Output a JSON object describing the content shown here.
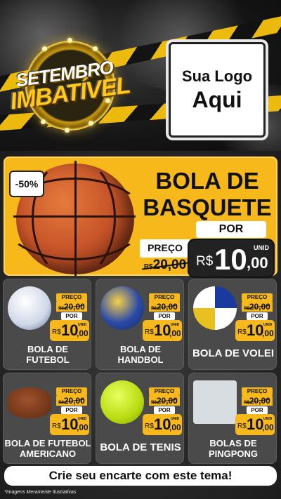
{
  "header": {
    "badge_line1": "SETEMBRO",
    "badge_line2": "IMBATÍVEL",
    "logo_line1": "Sua Logo",
    "logo_line2": "Aqui"
  },
  "featured": {
    "discount": "-50%",
    "title_line1": "BOLA DE",
    "title_line2": "BASQUETE",
    "preco_label": "PREÇO",
    "old_currency": "R$",
    "old_price": "20,00",
    "por_label": "POR",
    "currency": "R$",
    "price_int": "10",
    "price_dec": ",00",
    "unit": "UNID",
    "image_icon": "basketball-icon"
  },
  "products": [
    {
      "name_line1": "BOLA DE",
      "name_line2": "FUTEBOL",
      "icon": "soccer-ball-icon",
      "preco_label": "PREÇO",
      "old_currency": "R$",
      "old_price": "20,00",
      "por_label": "POR",
      "currency": "R$",
      "price_int": "10",
      "price_dec": ",00",
      "unit": "UNID"
    },
    {
      "name_line1": "BOLA DE",
      "name_line2": "HANDBOL",
      "icon": "handball-icon",
      "preco_label": "PREÇO",
      "old_currency": "R$",
      "old_price": "20,00",
      "por_label": "POR",
      "currency": "R$",
      "price_int": "10",
      "price_dec": ",00",
      "unit": "UNID"
    },
    {
      "name_line1": "BOLA DE VOLEI",
      "name_line2": "",
      "icon": "volleyball-icon",
      "preco_label": "PREÇO",
      "old_currency": "R$",
      "old_price": "20,00",
      "por_label": "POR",
      "currency": "R$",
      "price_int": "10",
      "price_dec": ",00",
      "unit": "UNID"
    },
    {
      "name_line1": "BOLA DE FUTEBOL",
      "name_line2": "AMERICANO",
      "icon": "football-icon",
      "preco_label": "PREÇO",
      "old_currency": "R$",
      "old_price": "20,00",
      "por_label": "POR",
      "currency": "R$",
      "price_int": "10",
      "price_dec": ",00",
      "unit": "UNID"
    },
    {
      "name_line1": "BOLA DE TENIS",
      "name_line2": "",
      "icon": "tennis-ball-icon",
      "preco_label": "PREÇO",
      "old_currency": "R$",
      "old_price": "20,00",
      "por_label": "POR",
      "currency": "R$",
      "price_int": "10",
      "price_dec": ",00",
      "unit": "UNID"
    },
    {
      "name_line1": "BOLAS DE",
      "name_line2": "PINGPONG",
      "icon": "pingpong-balls-icon",
      "preco_label": "PREÇO",
      "old_currency": "R$",
      "old_price": "20,00",
      "por_label": "POR",
      "currency": "R$",
      "price_int": "10",
      "price_dec": ",00",
      "unit": "UNID"
    }
  ],
  "cta": "Crie seu encarte com este tema!",
  "disclaimer": "*Imagens Meramente Ilustrativas",
  "colors": {
    "accent": "#f6b81b",
    "dark": "#222222",
    "card": "#4a4a4a"
  }
}
